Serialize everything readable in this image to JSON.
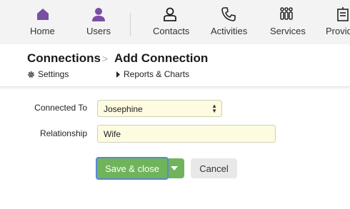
{
  "nav": {
    "items": [
      {
        "label": "Home",
        "icon": "home-icon"
      },
      {
        "label": "Users",
        "icon": "user-icon"
      },
      {
        "label": "Contacts",
        "icon": "contacts-icon"
      },
      {
        "label": "Activities",
        "icon": "phone-icon"
      },
      {
        "label": "Services",
        "icon": "services-icon"
      },
      {
        "label": "Provid",
        "icon": "provider-icon"
      }
    ]
  },
  "header": {
    "breadcrumb_parent": "Connections",
    "breadcrumb_separator": ">",
    "breadcrumb_current": "Add Connection",
    "settings_label": "Settings",
    "reports_label": "Reports & Charts"
  },
  "form": {
    "connected_to_label": "Connected To",
    "connected_to_value": "Josephine",
    "relationship_label": "Relationship",
    "relationship_value": "Wife"
  },
  "actions": {
    "save_label": "Save & close",
    "cancel_label": "Cancel"
  },
  "colors": {
    "accent_purple": "#7a4fa3",
    "save_green": "#6fb45a",
    "field_bg": "#fdfbe0",
    "focus_blue": "#5b86d8"
  }
}
